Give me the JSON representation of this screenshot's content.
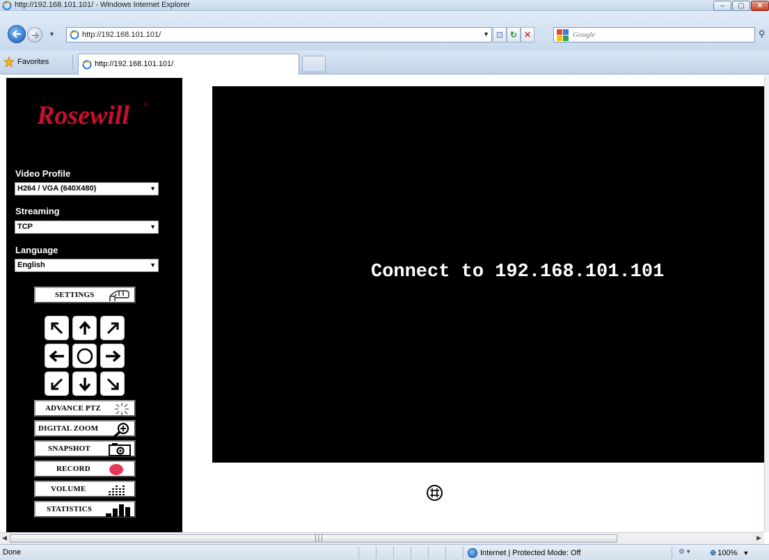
{
  "window": {
    "title": "http://192.168.101.101/ - Windows Internet Explorer",
    "controls": {
      "minimize": "–",
      "maximize": "▢",
      "close": "✕"
    }
  },
  "address_bar": {
    "url": "http://192.168.101.101/",
    "search_placeholder": "Google"
  },
  "favorites_bar": {
    "favorites_label": "Favorites",
    "tab_label": "http://192.168.101.101/"
  },
  "sidebar": {
    "logo_text": "Rosewill",
    "video_profile": {
      "label": "Video Profile",
      "value": "H264 / VGA (640X480)"
    },
    "streaming": {
      "label": "Streaming",
      "value": "TCP"
    },
    "language": {
      "label": "Language",
      "value": "English"
    },
    "buttons": {
      "settings": "SETTINGS",
      "advance_ptz": "ADVANCE PTZ",
      "digital_zoom": "DIGITAL ZOOM",
      "snapshot": "SNAPSHOT",
      "record": "RECORD",
      "volume": "VOLUME",
      "statistics": "STATISTICS"
    }
  },
  "video": {
    "message": "Connect to 192.168.101.101"
  },
  "status_bar": {
    "status": "Done",
    "zone": "Internet | Protected Mode: Off",
    "zoom": "100%"
  },
  "colors": {
    "sidebar_bg": "#000000",
    "video_bg": "#000000",
    "record_dot": "#e8365a",
    "chrome_blue": "#c9daee"
  }
}
